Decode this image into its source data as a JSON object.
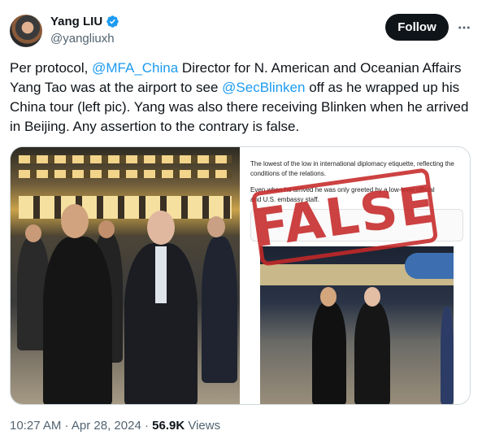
{
  "author": {
    "display_name": "Yang LIU",
    "handle": "@yangliuxh",
    "verified": true
  },
  "actions": {
    "follow_label": "Follow",
    "more_icon": "more-horizontal-icon"
  },
  "tweet": {
    "text_1": "Per protocol, ",
    "mention_1": "@MFA_China",
    "text_2": " Director for N. American and Oceanian Affairs Yang Tao was at the airport to see ",
    "mention_2": "@SecBlinken",
    "text_3": " off as he wrapped up his China tour (left pic). Yang was also there receiving Blinken when he arrived in Beijing. Any assertion to the contrary is false."
  },
  "media": {
    "right_image": {
      "line_1": "The lowest of the low in international diplomacy etiquette, reflecting the",
      "line_2": "conditions of the relations.",
      "line_3": "Even when he arrived he was only greeted by a low-level official",
      "line_4": "and U.S. embassy staff.",
      "stamp": "FALSE"
    }
  },
  "meta": {
    "time": "10:27 AM",
    "separator_1": " · ",
    "date": "Apr 28, 2024",
    "separator_2": " · ",
    "views_count": "56.9K",
    "views_label": " Views"
  },
  "colors": {
    "link": "#1d9bf0",
    "verified": "#1d9bf0",
    "follow_bg": "#0f1419",
    "stamp": "#c62828"
  }
}
